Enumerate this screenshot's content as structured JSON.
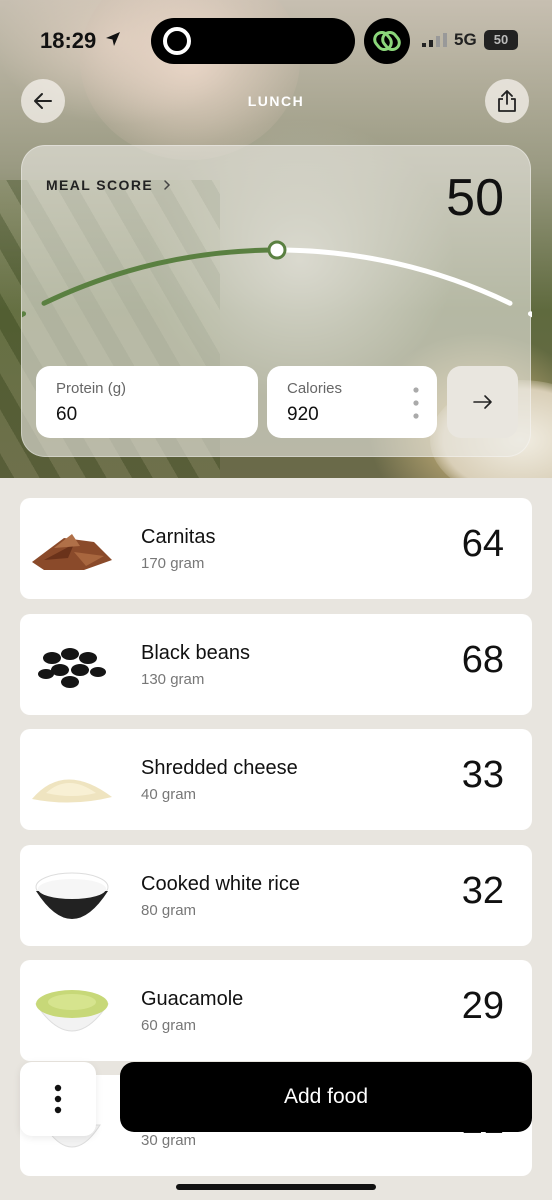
{
  "status_bar": {
    "time": "18:29",
    "network": "5G",
    "battery": "50"
  },
  "header": {
    "title": "LUNCH"
  },
  "meal_score": {
    "label": "MEAL SCORE",
    "value": "50",
    "level": 0.5,
    "colors": {
      "filled": "#5a8041",
      "empty": "#ffffff"
    }
  },
  "stats": {
    "protein_label": "Protein (g)",
    "protein_value": "60",
    "calories_label": "Calories",
    "calories_value": "920"
  },
  "foods": [
    {
      "name": "Carnitas",
      "qty": "170 gram",
      "score": "64"
    },
    {
      "name": "Black beans",
      "qty": "130 gram",
      "score": "68"
    },
    {
      "name": "Shredded cheese",
      "qty": "40 gram",
      "score": "33"
    },
    {
      "name": "Cooked white rice",
      "qty": "80 gram",
      "score": "32"
    },
    {
      "name": "Guacamole",
      "qty": "60 gram",
      "score": "29"
    },
    {
      "name": "",
      "qty": "30 gram",
      "score": "21"
    }
  ],
  "actions": {
    "add_food_label": "Add food"
  }
}
